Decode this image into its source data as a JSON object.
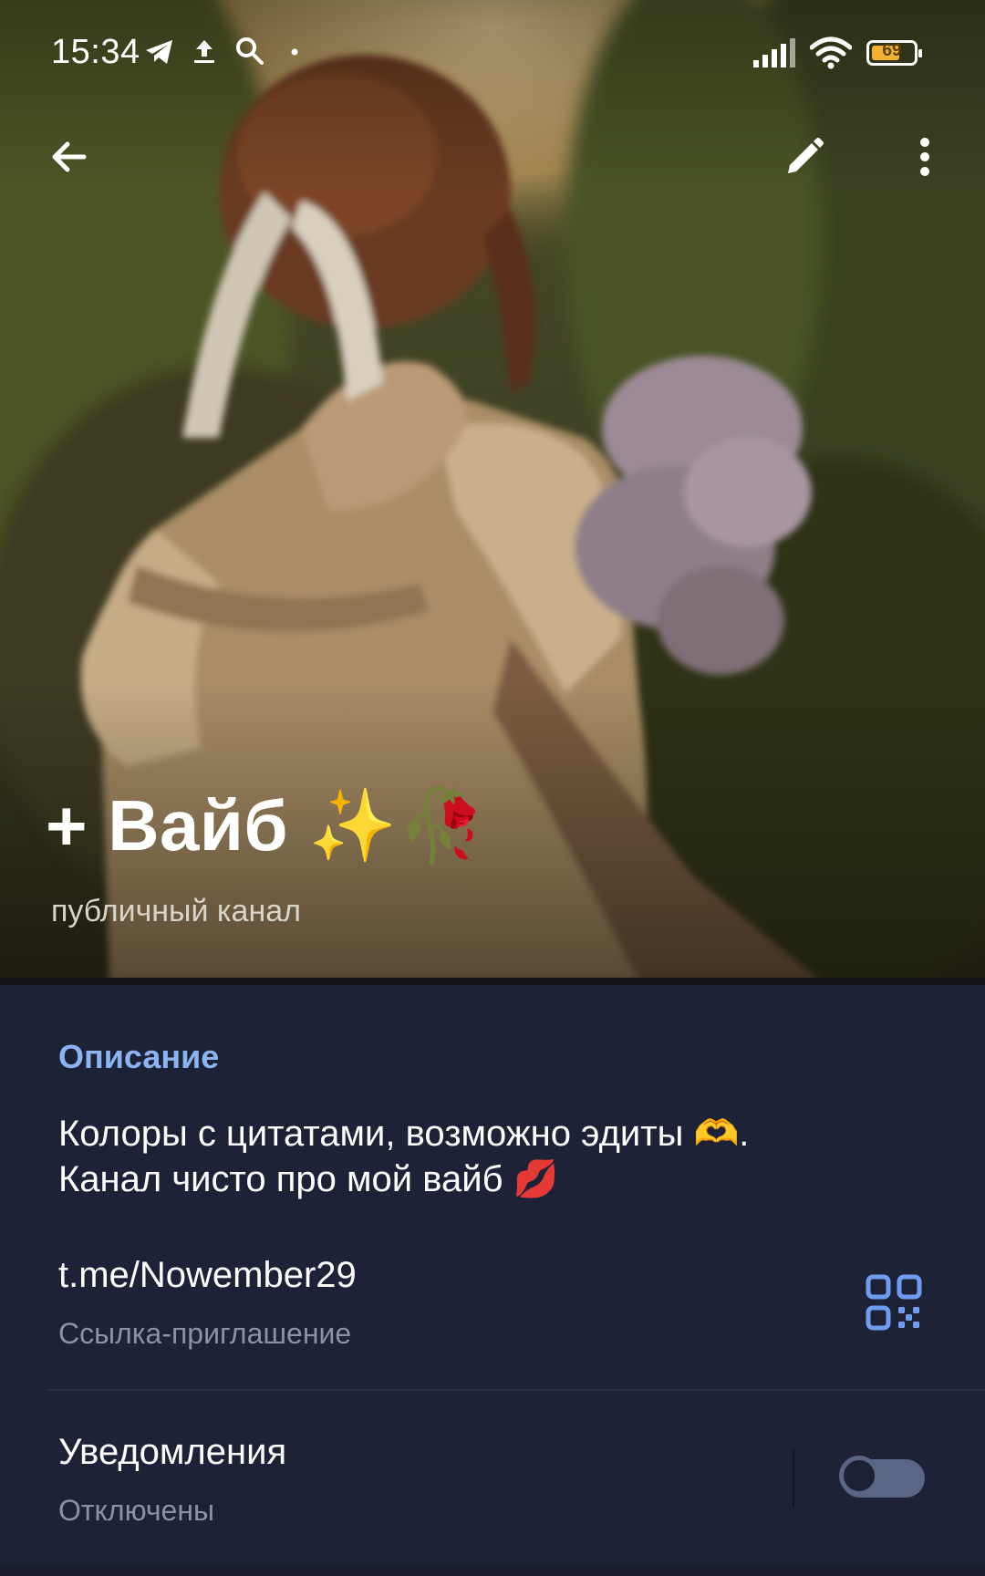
{
  "status_bar": {
    "time": "15:34",
    "battery": "69",
    "battery_level": 0.69,
    "icons": [
      "telegram-icon",
      "upload-icon",
      "search-icon",
      "dot-icon",
      "signal-icon",
      "wifi-icon",
      "battery-icon"
    ]
  },
  "app_bar": {
    "back_icon": "arrow-back-icon",
    "edit_icon": "pencil-icon",
    "more_icon": "more-vertical-icon"
  },
  "channel": {
    "title": "+ Вайб ✨🥀",
    "subtitle": "публичный канал"
  },
  "description": {
    "label": "Описание",
    "line1": "Колоры с цитатами, возможно эдиты 🫶.",
    "line2": "Канал чисто про мой вайб 💋"
  },
  "invite": {
    "link": "t.me/Nowember29",
    "label": "Ссылка-приглашение",
    "icon": "qr-code-icon"
  },
  "notifications": {
    "label": "Уведомления",
    "state": "Отключены",
    "enabled": false
  },
  "colors": {
    "background": "#1e2236",
    "accent": "#8db4f2",
    "secondary_text": "#8b91a6",
    "toggle_off": "#5b6584"
  }
}
